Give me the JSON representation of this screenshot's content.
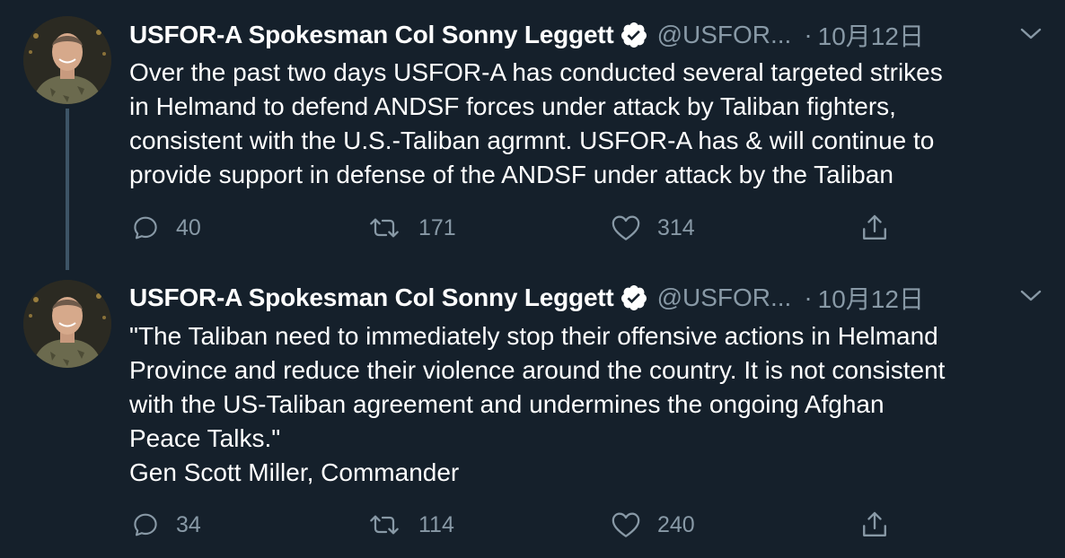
{
  "colors": {
    "background": "#15202b",
    "text_primary": "#ffffff",
    "text_secondary": "#8899a6",
    "thread_line": "#3d5466",
    "verified_badge": "#ffffff"
  },
  "tweets": [
    {
      "author_name": "USFOR-A Spokesman Col Sonny Leggett",
      "handle": "@USFOR...",
      "separator": "·",
      "date": "10月12日",
      "avatar_icon": "profile-photo",
      "verified_icon": "verified-badge-icon",
      "menu_icon": "chevron-down-icon",
      "body_lines": [
        "Over the past two days USFOR-A has conducted several targeted strikes",
        "in Helmand to defend ANDSF forces under attack by Taliban fighters,",
        "consistent with the U.S.-Taliban agrmnt. USFOR-A has & will continue to",
        "provide support in defense of the ANDSF under attack by the Taliban"
      ],
      "replies": "40",
      "retweets": "171",
      "likes": "314",
      "reply_icon": "reply-icon",
      "retweet_icon": "retweet-icon",
      "like_icon": "heart-icon",
      "share_icon": "share-icon"
    },
    {
      "author_name": "USFOR-A Spokesman Col Sonny Leggett",
      "handle": "@USFOR...",
      "separator": "·",
      "date": "10月12日",
      "avatar_icon": "profile-photo",
      "verified_icon": "verified-badge-icon",
      "menu_icon": "chevron-down-icon",
      "body_lines": [
        "\"The Taliban need to immediately stop their offensive actions in Helmand",
        "Province and reduce their violence around the country. It is not consistent",
        "with the US-Taliban agreement and undermines the ongoing Afghan",
        "Peace Talks.\"",
        "Gen Scott Miller, Commander"
      ],
      "replies": "34",
      "retweets": "114",
      "likes": "240",
      "reply_icon": "reply-icon",
      "retweet_icon": "retweet-icon",
      "like_icon": "heart-icon",
      "share_icon": "share-icon"
    }
  ]
}
